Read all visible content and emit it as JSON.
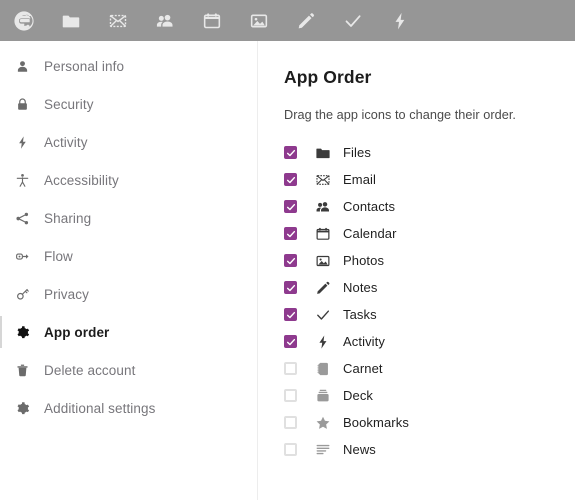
{
  "app_bar": {
    "items": [
      {
        "name": "logo-e-icon",
        "title": "Home",
        "icon": "logo-e"
      },
      {
        "name": "appbar-files",
        "title": "Files",
        "icon": "folder"
      },
      {
        "name": "appbar-email",
        "title": "Email",
        "icon": "envelope"
      },
      {
        "name": "appbar-contacts",
        "title": "Contacts",
        "icon": "people"
      },
      {
        "name": "appbar-calendar",
        "title": "Calendar",
        "icon": "calendar"
      },
      {
        "name": "appbar-photos",
        "title": "Photos",
        "icon": "image"
      },
      {
        "name": "appbar-notes",
        "title": "Notes",
        "icon": "pencil"
      },
      {
        "name": "appbar-tasks",
        "title": "Tasks",
        "icon": "check"
      },
      {
        "name": "appbar-activity",
        "title": "Activity",
        "icon": "bolt"
      }
    ]
  },
  "sidebar": {
    "items": [
      {
        "label": "Personal info",
        "icon": "person",
        "active": false
      },
      {
        "label": "Security",
        "icon": "lock",
        "active": false
      },
      {
        "label": "Activity",
        "icon": "bolt",
        "active": false
      },
      {
        "label": "Accessibility",
        "icon": "accessibility",
        "active": false
      },
      {
        "label": "Sharing",
        "icon": "share",
        "active": false
      },
      {
        "label": "Flow",
        "icon": "flow",
        "active": false
      },
      {
        "label": "Privacy",
        "icon": "key",
        "active": false
      },
      {
        "label": "App order",
        "icon": "gear",
        "active": true
      },
      {
        "label": "Delete account",
        "icon": "trash",
        "active": false
      },
      {
        "label": "Additional settings",
        "icon": "gear",
        "active": false
      }
    ]
  },
  "main": {
    "title": "App Order",
    "description": "Drag the app icons to change their order.",
    "apps": [
      {
        "label": "Files",
        "icon": "folder",
        "checked": true
      },
      {
        "label": "Email",
        "icon": "envelope",
        "checked": true
      },
      {
        "label": "Contacts",
        "icon": "people",
        "checked": true
      },
      {
        "label": "Calendar",
        "icon": "calendar",
        "checked": true
      },
      {
        "label": "Photos",
        "icon": "image",
        "checked": true
      },
      {
        "label": "Notes",
        "icon": "pencil",
        "checked": true
      },
      {
        "label": "Tasks",
        "icon": "check",
        "checked": true
      },
      {
        "label": "Activity",
        "icon": "bolt",
        "checked": true
      },
      {
        "label": "Carnet",
        "icon": "carnet",
        "checked": false
      },
      {
        "label": "Deck",
        "icon": "deck",
        "checked": false
      },
      {
        "label": "Bookmarks",
        "icon": "star",
        "checked": false
      },
      {
        "label": "News",
        "icon": "news",
        "checked": false
      }
    ]
  },
  "colors": {
    "appbar_background": "#969696",
    "accent_purple": "#8e3a8e",
    "active_text": "#1c1c1c",
    "muted_text": "#77767b"
  }
}
